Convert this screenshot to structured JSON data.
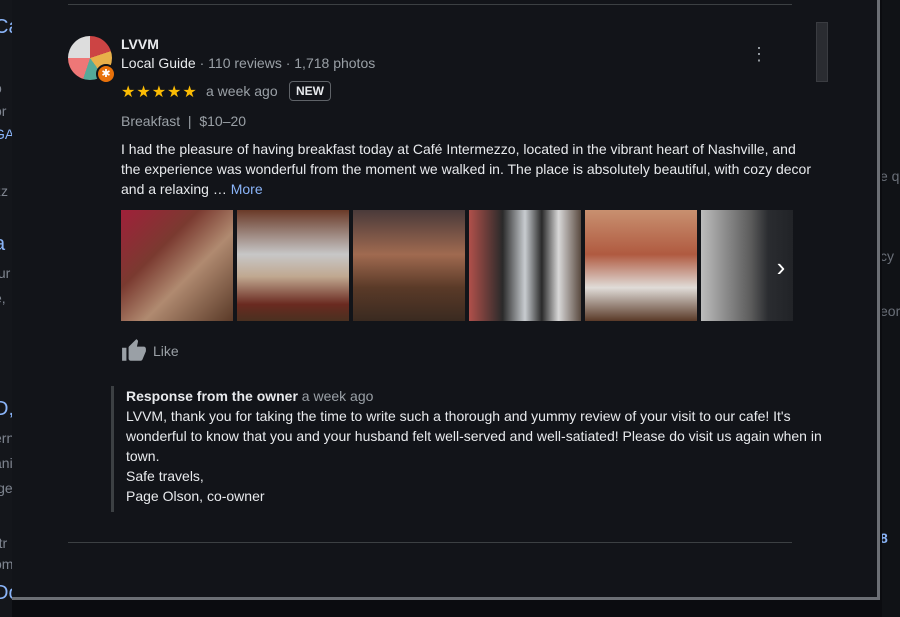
{
  "background": {
    "left_fragments": [
      "Ca",
      "o",
      "or",
      "GA",
      "zz",
      "a",
      "tur",
      "e,",
      "›",
      "D,",
      "ern",
      "ani",
      "ige",
      "rtr",
      "om",
      "Do"
    ],
    "right_fragments": [
      "e q",
      "cy",
      "eor",
      "8"
    ]
  },
  "review": {
    "author_name": "LVVM",
    "author_level": "Local Guide",
    "author_stats": " · 110 reviews · 1,718 photos",
    "rating": 5,
    "rating_max": 5,
    "stars": "★★★★★",
    "time_ago": "a week ago",
    "new_badge": "NEW",
    "menu_icon": "⋮",
    "attributes": "Breakfast  |  $10–20",
    "text": "I had the pleasure of having breakfast today at Café Intermezzo, located in the vibrant heart of Nashville, and the experience was wonderful from the moment we walked in. The place is absolutely beautiful, with cozy decor and a relaxing … ",
    "more_label": "More",
    "photos": [
      {
        "alt": "Cafe interior with red lighting"
      },
      {
        "alt": "Pastry display case"
      },
      {
        "alt": "Bar counter with stools"
      },
      {
        "alt": "Dining area by windows with wreath"
      },
      {
        "alt": "Dining room with tables"
      },
      {
        "alt": "Window seating"
      }
    ],
    "next_icon": "›",
    "like_label": "Like"
  },
  "owner_response": {
    "title": "Response from the owner",
    "time_ago": " a week ago",
    "text": "LVVM, thank you for taking the time to write such a thorough and yummy review of your visit to our cafe! It's wonderful to know that you and your husband felt well-served and well-satiated! Please do visit us again when in town.\nSafe travels,\nPage Olson, co-owner"
  },
  "colors": {
    "star": "#fbbc04",
    "link": "#8ab4f8",
    "local_guide_badge": "#e8710a"
  }
}
